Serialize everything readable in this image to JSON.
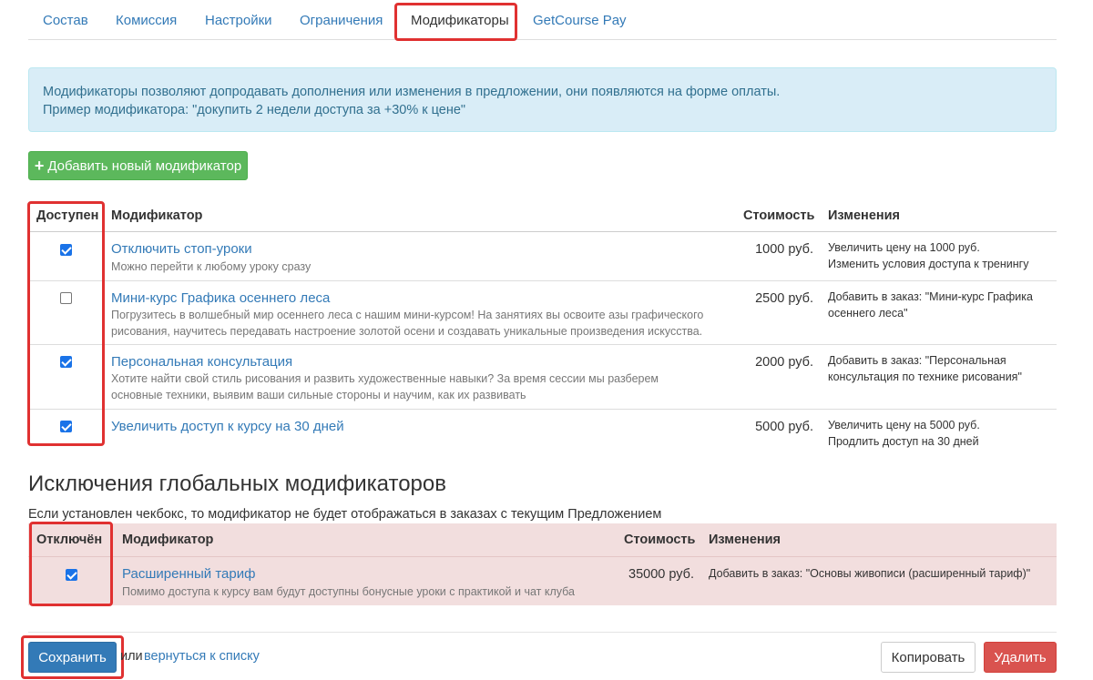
{
  "tabs": [
    "Состав",
    "Комиссия",
    "Настройки",
    "Ограничения",
    "Модификаторы",
    "GetCourse Pay"
  ],
  "info": {
    "line1": "Модификаторы позволяют допродавать дополнения или изменения в предложении, они появляются на форме оплаты.",
    "line2": "Пример модификатора: \"докупить 2 недели доступа за +30% к цене\""
  },
  "add_button": "Добавить новый модификатор",
  "table": {
    "headers": {
      "available": "Доступен",
      "modifier": "Модификатор",
      "cost": "Стоимость",
      "changes": "Изменения"
    },
    "rows": [
      {
        "checked": true,
        "name": "Отключить стоп-уроки",
        "desc": "Можно перейти к любому уроку сразу",
        "price": "1000 руб.",
        "changes": [
          "Увеличить цену на 1000 руб.",
          "Изменить условия доступа к тренингу"
        ]
      },
      {
        "checked": false,
        "name": "Мини-курс Графика осеннего леса",
        "desc": "Погрузитесь в волшебный мир осеннего леса с нашим мини-курсом! На занятиях вы освоите азы графического рисования, научитесь передавать настроение золотой осени и создавать уникальные произведения искусства.",
        "price": "2500 руб.",
        "changes": [
          "Добавить в заказ: \"Мини-курс Графика",
          "осеннего леса\""
        ]
      },
      {
        "checked": true,
        "name": "Персональная консультация",
        "desc": "Хотите найти свой стиль рисования и развить художественные навыки? За время сессии мы разберем основные техники, выявим ваши сильные стороны и научим, как их развивать",
        "price": "2000 руб.",
        "changes": [
          "Добавить в заказ: \"Персональная",
          "консультация по технике рисования\""
        ]
      },
      {
        "checked": true,
        "name": "Увеличить доступ к курсу на 30 дней",
        "desc": "",
        "price": "5000 руб.",
        "changes": [
          "Увеличить цену на 5000 руб.",
          "Продлить доступ на 30 дней"
        ]
      }
    ]
  },
  "global": {
    "title": "Исключения глобальных модификаторов",
    "subtitle": "Если установлен чекбокс, то модификатор не будет отображаться в заказах с текущим Предложением",
    "headers": {
      "disabled": "Отключён",
      "modifier": "Модификатор",
      "cost": "Стоимость",
      "changes": "Изменения"
    },
    "row": {
      "checked": true,
      "name": "Расширенный тариф",
      "desc": "Помимо доступа к курсу вам будут доступны бонусные уроки с практикой и чат клуба",
      "price": "35000 руб.",
      "changes": "Добавить в заказ: \"Основы живописи (расширенный тариф)\""
    }
  },
  "footer": {
    "save": "Сохранить",
    "or": "или",
    "back": "вернуться к списку",
    "copy": "Копировать",
    "delete": "Удалить"
  },
  "colors": {
    "highlight": "#e03131",
    "link": "#337ab7",
    "success": "#5cb85c",
    "danger": "#d9534f",
    "info_bg": "#d9edf7",
    "exclusion_bg": "#f2dede"
  }
}
